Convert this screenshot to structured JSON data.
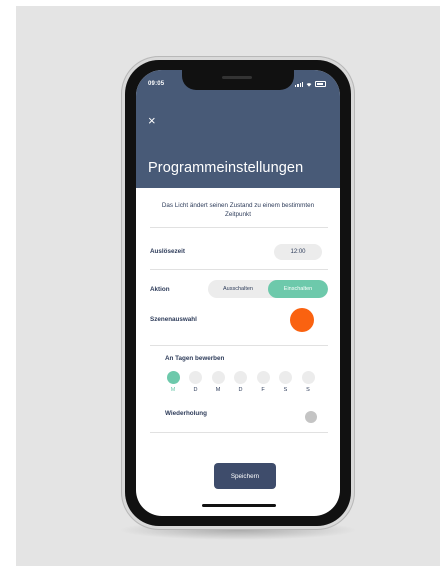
{
  "status_bar": {
    "time": "09:05"
  },
  "header": {
    "close_label": "×",
    "title": "Programmeinstellungen"
  },
  "description": "Das Licht ändert seinen Zustand zu einem bestimmten Zeitpunkt",
  "trigger": {
    "label": "Auslösezeit",
    "value": "12:00"
  },
  "action": {
    "label": "Aktion",
    "options": [
      "Ausschalten",
      "Einschalten"
    ],
    "selected": "Einschalten"
  },
  "scene": {
    "label": "Szenenauswahl",
    "color": "#fa6210"
  },
  "days": {
    "label": "An Tagen bewerben",
    "items": [
      {
        "letter": "M",
        "active": true
      },
      {
        "letter": "D",
        "active": false
      },
      {
        "letter": "M",
        "active": false
      },
      {
        "letter": "D",
        "active": false
      },
      {
        "letter": "F",
        "active": false
      },
      {
        "letter": "S",
        "active": false
      },
      {
        "letter": "S",
        "active": false
      }
    ]
  },
  "repeat": {
    "label": "Wiederholung"
  },
  "save_button": {
    "label": "Speichern"
  },
  "colors": {
    "header": "#485a77",
    "accent": "#6dc9ab",
    "button": "#3e4c6b"
  }
}
